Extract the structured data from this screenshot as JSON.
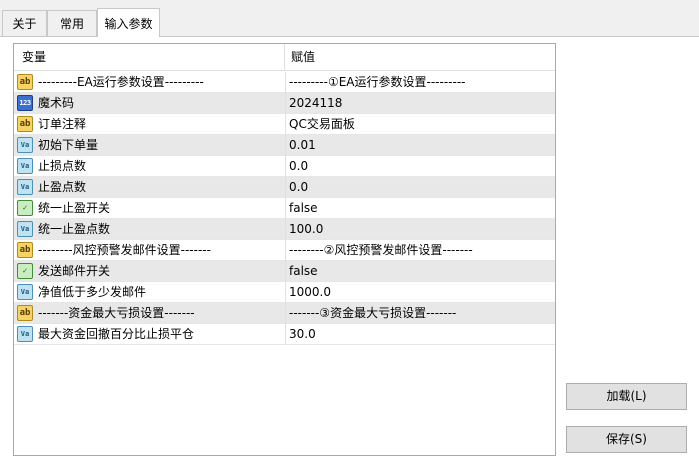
{
  "tabs": [
    {
      "label": "关于"
    },
    {
      "label": "常用"
    },
    {
      "label": "输入参数"
    }
  ],
  "table": {
    "headers": [
      "变量",
      "赋值"
    ],
    "rows": [
      {
        "icon": "ab",
        "name": "---------EA运行参数设置---------",
        "value": "---------①EA运行参数设置---------"
      },
      {
        "icon": "123",
        "name": "魔术码",
        "value": "2024118"
      },
      {
        "icon": "ab",
        "name": "订单注释",
        "value": "QC交易面板"
      },
      {
        "icon": "val",
        "name": "初始下单量",
        "value": "0.01"
      },
      {
        "icon": "val",
        "name": "止损点数",
        "value": "0.0"
      },
      {
        "icon": "val",
        "name": "止盈点数",
        "value": "0.0"
      },
      {
        "icon": "bool",
        "name": "统一止盈开关",
        "value": "false"
      },
      {
        "icon": "val",
        "name": "统一止盈点数",
        "value": "100.0"
      },
      {
        "icon": "ab",
        "name": "--------风控预警发邮件设置-------",
        "value": "--------②风控预警发邮件设置-------"
      },
      {
        "icon": "bool",
        "name": "发送邮件开关",
        "value": "false"
      },
      {
        "icon": "val",
        "name": "净值低于多少发邮件",
        "value": "1000.0"
      },
      {
        "icon": "ab",
        "name": "-------资金最大亏损设置-------",
        "value": "-------③资金最大亏损设置-------"
      },
      {
        "icon": "val",
        "name": "最大资金回撤百分比止损平仓",
        "value": "30.0"
      }
    ]
  },
  "buttons": {
    "load": "加载(L)",
    "save": "保存(S)"
  },
  "icon_glyphs": {
    "ab": "ab",
    "123": "123",
    "val": "Va",
    "bool": "✓"
  }
}
